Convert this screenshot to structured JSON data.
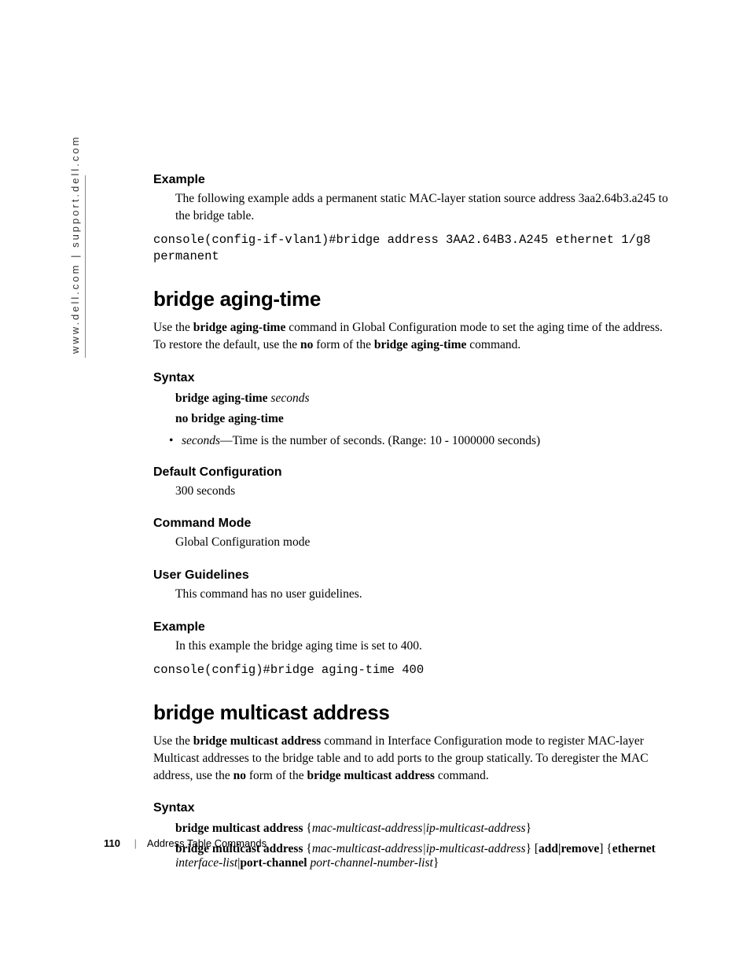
{
  "sidebar": "www.dell.com | support.dell.com",
  "sec1": {
    "example_h": "Example",
    "example_p": "The following example adds a permanent static MAC-layer station source address 3aa2.64b3.a245 to the bridge table.",
    "code": "console(config-if-vlan1)#bridge address 3AA2.64B3.A245 ethernet 1/g8 permanent"
  },
  "sec2": {
    "title": "bridge aging-time",
    "intro_pre": "Use the ",
    "intro_cmd": "bridge aging-time",
    "intro_mid": " command in Global Configuration mode to set the aging time of the address. To restore the default, use the ",
    "intro_no": "no",
    "intro_mid2": " form of the ",
    "intro_cmd2": "bridge aging-time",
    "intro_post": " command.",
    "syntax_h": "Syntax",
    "syn1_b": "bridge aging-time ",
    "syn1_i": "seconds",
    "syn2_b": "no bridge aging-time",
    "bullet_i": "seconds",
    "bullet_rest": "—Time is the number of seconds. (Range: 10 - 1000000 seconds)",
    "default_h": "Default Configuration",
    "default_p": "300 seconds",
    "mode_h": "Command Mode",
    "mode_p": "Global Configuration mode",
    "guide_h": "User Guidelines",
    "guide_p": "This command has no user guidelines.",
    "example_h": "Example",
    "example_p": "In this example the bridge aging time is set to 400.",
    "code": "console(config)#bridge aging-time 400"
  },
  "sec3": {
    "title": "bridge multicast address",
    "intro_pre": "Use the ",
    "intro_cmd": "bridge multicast address",
    "intro_mid": " command in Interface Configuration mode to register MAC-layer Multicast addresses to the bridge table and to add ports to the group statically. To deregister the MAC address, use the ",
    "intro_no": "no",
    "intro_mid2": " form of the ",
    "intro_cmd2": "bridge multicast address",
    "intro_post": " command.",
    "syntax_h": "Syntax",
    "syn1_b": "bridge multicast address",
    "syn1_brace_o": " {",
    "syn1_i": "mac-multicast-address|ip-multicast-address",
    "syn1_brace_c": "}",
    "syn2_b": "bridge multicast address",
    "syn2_brace_o": " {",
    "syn2_i": "mac-multicast-address|ip-multicast-address",
    "syn2_brace_c": "} [",
    "syn2_addrem": "add|remove",
    "syn2_close": "] {",
    "syn2_eth": "ethernet",
    "syn2_space": " ",
    "syn2_il": "interface-list",
    "syn2_pipe": "|",
    "syn2_pc": "port-channel",
    "syn2_space2": " ",
    "syn2_pcnl": "port-channel-number-list",
    "syn2_end": "}"
  },
  "footer": {
    "page": "110",
    "section": "Address Table Commands"
  }
}
